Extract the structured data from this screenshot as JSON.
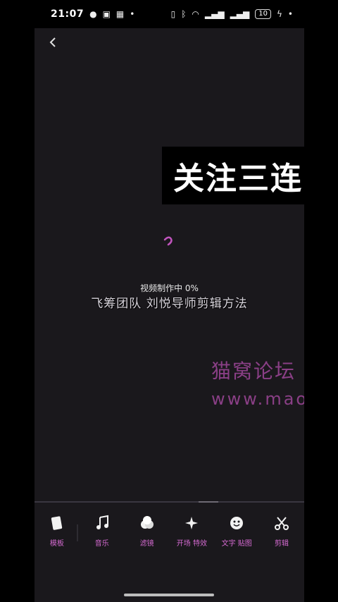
{
  "status_bar": {
    "time": "21:07",
    "battery": "10",
    "left_icons": [
      "wechat-icon",
      "camera-app-icon",
      "grid-app-icon",
      "dot-icon"
    ],
    "right_icons": [
      "vibrate-icon",
      "bluetooth-icon",
      "wifi-icon",
      "signal-icon",
      "signal-icon",
      "charging-icon",
      "dot-icon"
    ]
  },
  "editor": {
    "back_icon": "chevron-left-icon",
    "progress_text": "视频制作中 0%",
    "caption": "飞筹团队 刘悦导师剪辑方法"
  },
  "overlays": {
    "promo_banner": "关注三连",
    "watermark_title": "猫窝论坛",
    "watermark_url": "www.maowo.com",
    "watermark_color": "#8a3f86"
  },
  "toolbar": {
    "accent_color": "#d46ad0",
    "items": [
      {
        "label": "模板",
        "icon": "template-icon"
      },
      {
        "label": "音乐",
        "icon": "music-note-icon"
      },
      {
        "label": "滤镜",
        "icon": "filter-icon"
      },
      {
        "label": "开场 特效",
        "icon": "sparkle-icon"
      },
      {
        "label": "文字 贴图",
        "icon": "sticker-icon"
      },
      {
        "label": "剪辑",
        "icon": "scissors-icon"
      }
    ]
  }
}
